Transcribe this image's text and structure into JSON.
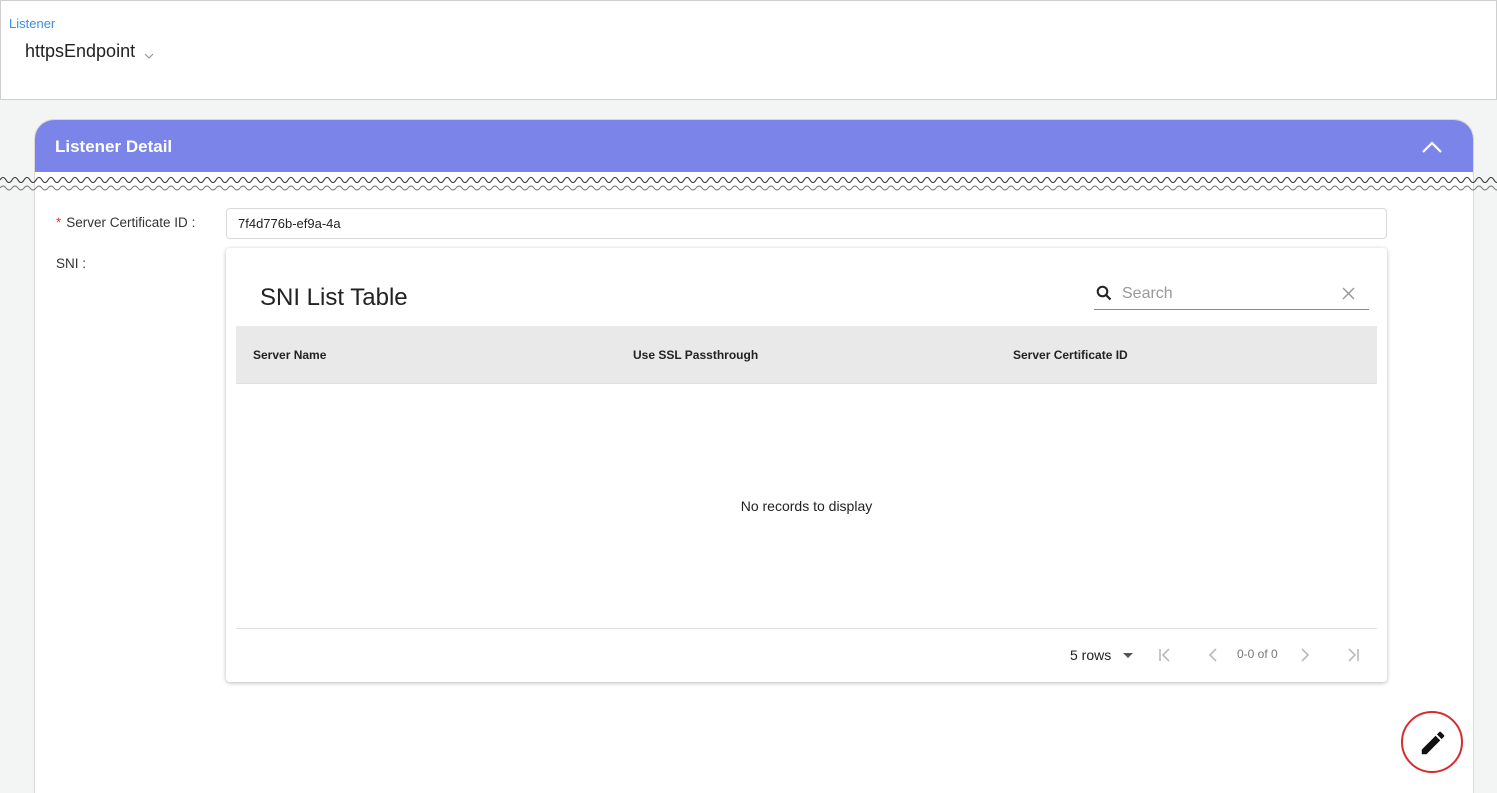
{
  "header": {
    "label": "Listener",
    "selected_listener": "httpsEndpoint"
  },
  "card": {
    "title": "Listener Detail"
  },
  "form": {
    "server_certificate_label": "Server Certificate ID",
    "server_certificate_value": "7f4d776b-ef9a-4a",
    "sni_label": "SNI"
  },
  "sni_table": {
    "title": "SNI List Table",
    "search_placeholder": "Search",
    "columns": [
      "Server Name",
      "Use SSL Passthrough",
      "Server Certificate ID"
    ],
    "empty_message": "No records to display",
    "rows_per_page": "5 rows",
    "page_info": "0-0 of 0"
  },
  "colors": {
    "header_bar": "#7b84e8",
    "required_marker": "#e53935",
    "label_link": "#3b8fd6",
    "fab_ring": "#d32f2f"
  },
  "icons": {
    "listener_dropdown": "chevron-down-icon",
    "collapse": "chevron-up-icon",
    "search": "search-icon",
    "clear": "close-icon",
    "first_page": "first-page-icon",
    "prev_page": "chevron-left-icon",
    "next_page": "chevron-right-icon",
    "last_page": "last-page-icon",
    "edit": "pencil-icon"
  }
}
